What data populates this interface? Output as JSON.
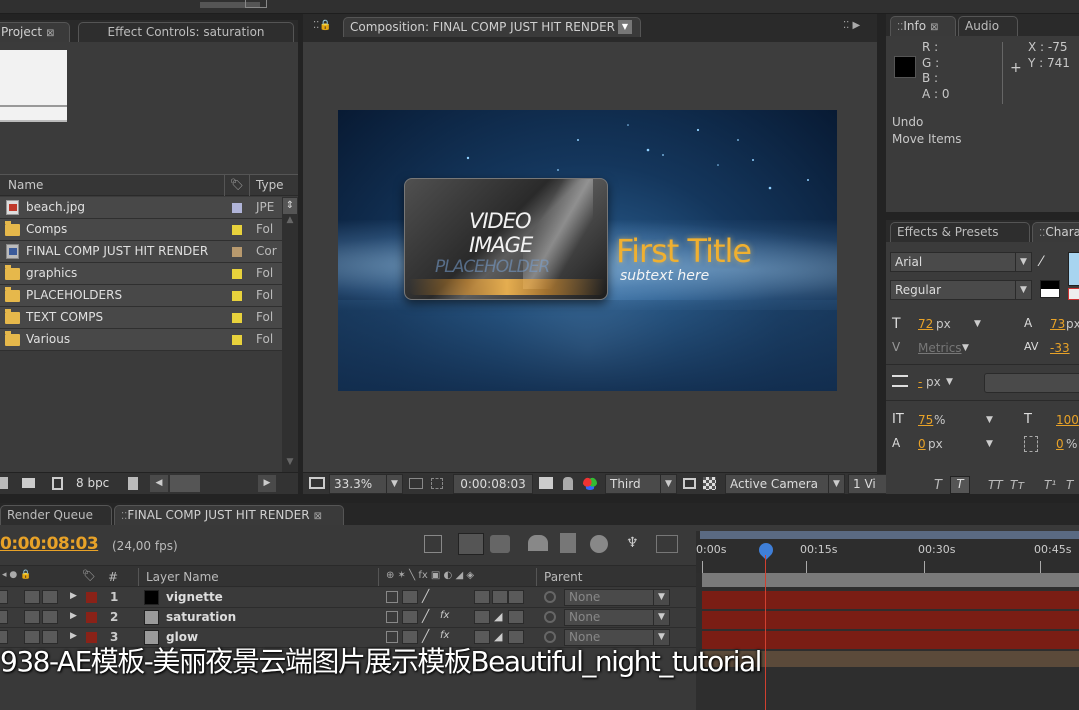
{
  "project_panel": {
    "tabs": {
      "project": "Project",
      "effect_controls": "Effect Controls: saturation"
    },
    "columns": {
      "name": "Name",
      "type": "Type"
    },
    "items": [
      {
        "name": "beach.jpg",
        "type": "JPE",
        "icon": "image-file-icon",
        "label_color": "#b0b4d8"
      },
      {
        "name": "Comps",
        "type": "Fol",
        "icon": "folder-icon",
        "label_color": "#e8d23c"
      },
      {
        "name": "FINAL COMP JUST HIT RENDER",
        "type": "Cor",
        "icon": "composition-icon",
        "label_color": "#b89a6e"
      },
      {
        "name": "graphics",
        "type": "Fol",
        "icon": "folder-icon",
        "label_color": "#e8d23c"
      },
      {
        "name": "PLACEHOLDERS",
        "type": "Fol",
        "icon": "folder-icon",
        "label_color": "#e8d23c"
      },
      {
        "name": "TEXT COMPS",
        "type": "Fol",
        "icon": "folder-icon",
        "label_color": "#e8d23c"
      },
      {
        "name": "Various",
        "type": "Fol",
        "icon": "folder-icon",
        "label_color": "#e8d23c"
      }
    ],
    "bpc": "8 bpc"
  },
  "composition_panel": {
    "tab": "Composition: FINAL COMP JUST HIT RENDER",
    "preview": {
      "card_line1": "VIDEO",
      "card_line2": "IMAGE",
      "card_line3": "PLACEHOLDER",
      "title": "First Title",
      "subtitle": "subtext here"
    },
    "footer": {
      "zoom": "33.3%",
      "timecode": "0:00:08:03",
      "resolution": "Third",
      "camera": "Active Camera",
      "views": "1 Vi"
    }
  },
  "info_panel": {
    "tabs": {
      "info": "Info",
      "audio": "Audio"
    },
    "r": "R :",
    "g": "G :",
    "b": "B :",
    "a": "A : 0",
    "x": "X : -75",
    "y": "Y : 741",
    "undo_label": "Undo",
    "undo_action": "Move Items"
  },
  "character_panel": {
    "tabs": {
      "effects": "Effects & Presets",
      "character": "Chara"
    },
    "font": "Arial",
    "style": "Regular",
    "font_size": "72",
    "font_size_unit": "px",
    "leading": "73",
    "leading_unit": "px",
    "kerning": "Metrics",
    "tracking": "-33",
    "stroke_width": "-",
    "stroke_unit": "px",
    "vert_scale": "75",
    "vert_scale_unit": "%",
    "horiz_scale": "100",
    "baseline": "0",
    "baseline_unit": "px",
    "tsume": "0",
    "tsume_unit": "%"
  },
  "timeline": {
    "tabs": {
      "render_queue": "Render Queue",
      "comp": "FINAL COMP JUST HIT RENDER"
    },
    "timecode": "0:00:08:03",
    "fps": "(24,00 fps)",
    "columns": {
      "num": "#",
      "layer_name": "Layer Name",
      "parent": "Parent"
    },
    "ruler": [
      "0:00s",
      "00:15s",
      "00:30s",
      "00:45s"
    ],
    "layers": [
      {
        "num": "1",
        "name": "vignette",
        "color": "#000000",
        "parent": "None"
      },
      {
        "num": "2",
        "name": "saturation",
        "color": "#9a9a9a",
        "parent": "None"
      },
      {
        "num": "3",
        "name": "glow",
        "color": "#9a9a9a",
        "parent": "None"
      }
    ]
  },
  "overlay_caption": "938-AE模板-美丽夜景云端图片展示模板Beautiful_night_tutorial"
}
